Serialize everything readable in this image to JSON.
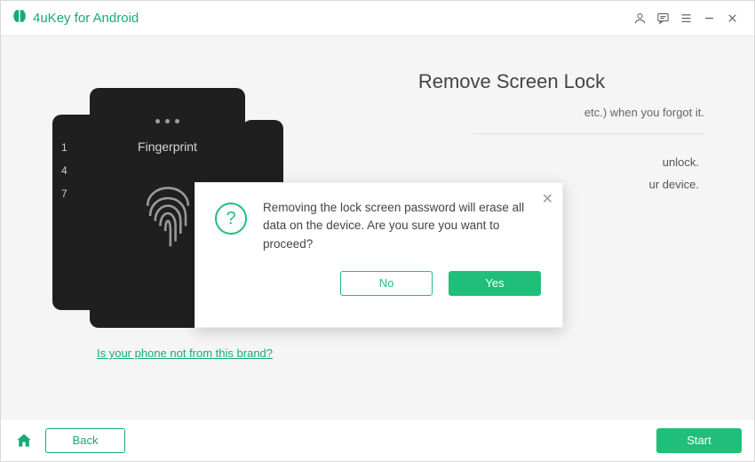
{
  "app": {
    "title": "4uKey for Android"
  },
  "illustration": {
    "pin_digits": [
      "1",
      "4",
      "7"
    ],
    "front_label": "Fingerprint"
  },
  "main": {
    "heading": "Remove Screen Lock",
    "line1_fragment": "etc.) when you forgot it.",
    "bullet1_fragment": "unlock.",
    "bullet2_fragment": "ur device."
  },
  "link": {
    "brand_question": "Is your phone not from this brand?"
  },
  "modal": {
    "message": "Removing the lock screen password will erase all data on the device. Are you sure you want to proceed?",
    "no": "No",
    "yes": "Yes",
    "close": "✕",
    "question_mark": "?"
  },
  "bottom": {
    "back": "Back",
    "start": "Start"
  },
  "icons": {
    "user": "user-icon",
    "feedback": "feedback-icon",
    "menu": "menu-icon",
    "minimize": "minimize-icon",
    "close": "close-icon",
    "home": "home-icon",
    "fingerprint": "fingerprint-icon",
    "logo": "app-logo-icon"
  }
}
